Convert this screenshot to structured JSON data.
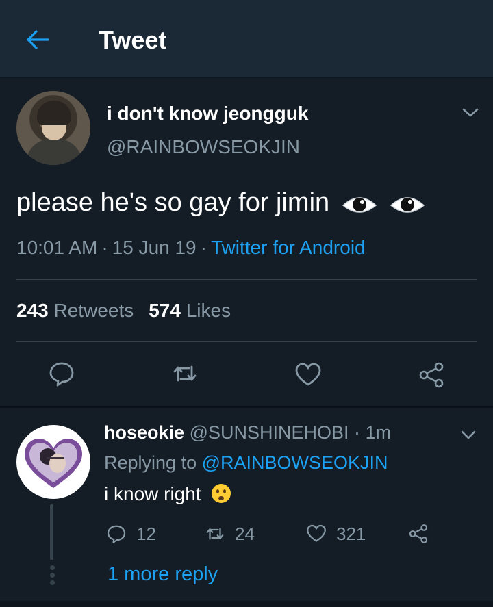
{
  "header": {
    "title": "Tweet",
    "back_icon": "arrow-left-icon"
  },
  "colors": {
    "background": "#141d26",
    "header_bg": "#1b2836",
    "accent": "#1da1f2",
    "secondary_text": "#8899a6",
    "divider": "#38444d"
  },
  "tweet": {
    "display_name": "i don't know jeongguk",
    "handle": "@RAINBOWSEOKJIN",
    "text": "please he's so gay for jimin",
    "emojis": [
      "eye-icon",
      "eye-icon"
    ],
    "time": "10:01 AM",
    "date": "15 Jun 19",
    "separator": "·",
    "source": "Twitter for Android",
    "retweets": "243",
    "retweets_label": "Retweets",
    "likes": "574",
    "likes_label": "Likes",
    "actions": [
      "reply-icon",
      "retweet-icon",
      "like-icon",
      "share-icon"
    ]
  },
  "reply": {
    "display_name": "hoseokie",
    "handle": "@SUNSHINEHOBI",
    "separator": "·",
    "time": "1m",
    "replying_prefix": "Replying to",
    "replying_to": "@RAINBOWSEOKJIN",
    "text": "i know right",
    "emoji": "frowning-face-icon",
    "reply_count": "12",
    "retweet_count": "24",
    "like_count": "321",
    "more_replies": "1 more reply"
  }
}
